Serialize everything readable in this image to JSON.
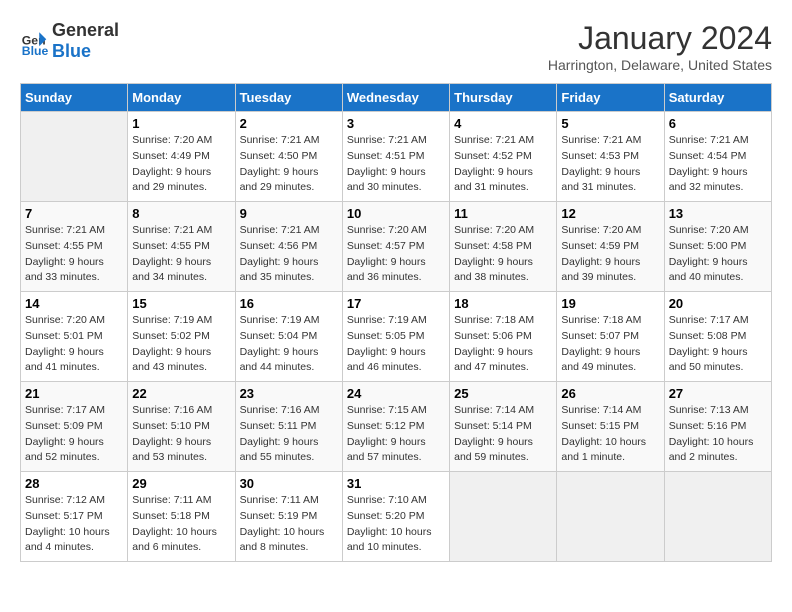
{
  "header": {
    "logo_line1": "General",
    "logo_line2": "Blue",
    "month": "January 2024",
    "location": "Harrington, Delaware, United States"
  },
  "weekdays": [
    "Sunday",
    "Monday",
    "Tuesday",
    "Wednesday",
    "Thursday",
    "Friday",
    "Saturday"
  ],
  "weeks": [
    [
      {
        "day": "",
        "info": ""
      },
      {
        "day": "1",
        "info": "Sunrise: 7:20 AM\nSunset: 4:49 PM\nDaylight: 9 hours\nand 29 minutes."
      },
      {
        "day": "2",
        "info": "Sunrise: 7:21 AM\nSunset: 4:50 PM\nDaylight: 9 hours\nand 29 minutes."
      },
      {
        "day": "3",
        "info": "Sunrise: 7:21 AM\nSunset: 4:51 PM\nDaylight: 9 hours\nand 30 minutes."
      },
      {
        "day": "4",
        "info": "Sunrise: 7:21 AM\nSunset: 4:52 PM\nDaylight: 9 hours\nand 31 minutes."
      },
      {
        "day": "5",
        "info": "Sunrise: 7:21 AM\nSunset: 4:53 PM\nDaylight: 9 hours\nand 31 minutes."
      },
      {
        "day": "6",
        "info": "Sunrise: 7:21 AM\nSunset: 4:54 PM\nDaylight: 9 hours\nand 32 minutes."
      }
    ],
    [
      {
        "day": "7",
        "info": "Sunrise: 7:21 AM\nSunset: 4:55 PM\nDaylight: 9 hours\nand 33 minutes."
      },
      {
        "day": "8",
        "info": "Sunrise: 7:21 AM\nSunset: 4:55 PM\nDaylight: 9 hours\nand 34 minutes."
      },
      {
        "day": "9",
        "info": "Sunrise: 7:21 AM\nSunset: 4:56 PM\nDaylight: 9 hours\nand 35 minutes."
      },
      {
        "day": "10",
        "info": "Sunrise: 7:20 AM\nSunset: 4:57 PM\nDaylight: 9 hours\nand 36 minutes."
      },
      {
        "day": "11",
        "info": "Sunrise: 7:20 AM\nSunset: 4:58 PM\nDaylight: 9 hours\nand 38 minutes."
      },
      {
        "day": "12",
        "info": "Sunrise: 7:20 AM\nSunset: 4:59 PM\nDaylight: 9 hours\nand 39 minutes."
      },
      {
        "day": "13",
        "info": "Sunrise: 7:20 AM\nSunset: 5:00 PM\nDaylight: 9 hours\nand 40 minutes."
      }
    ],
    [
      {
        "day": "14",
        "info": "Sunrise: 7:20 AM\nSunset: 5:01 PM\nDaylight: 9 hours\nand 41 minutes."
      },
      {
        "day": "15",
        "info": "Sunrise: 7:19 AM\nSunset: 5:02 PM\nDaylight: 9 hours\nand 43 minutes."
      },
      {
        "day": "16",
        "info": "Sunrise: 7:19 AM\nSunset: 5:04 PM\nDaylight: 9 hours\nand 44 minutes."
      },
      {
        "day": "17",
        "info": "Sunrise: 7:19 AM\nSunset: 5:05 PM\nDaylight: 9 hours\nand 46 minutes."
      },
      {
        "day": "18",
        "info": "Sunrise: 7:18 AM\nSunset: 5:06 PM\nDaylight: 9 hours\nand 47 minutes."
      },
      {
        "day": "19",
        "info": "Sunrise: 7:18 AM\nSunset: 5:07 PM\nDaylight: 9 hours\nand 49 minutes."
      },
      {
        "day": "20",
        "info": "Sunrise: 7:17 AM\nSunset: 5:08 PM\nDaylight: 9 hours\nand 50 minutes."
      }
    ],
    [
      {
        "day": "21",
        "info": "Sunrise: 7:17 AM\nSunset: 5:09 PM\nDaylight: 9 hours\nand 52 minutes."
      },
      {
        "day": "22",
        "info": "Sunrise: 7:16 AM\nSunset: 5:10 PM\nDaylight: 9 hours\nand 53 minutes."
      },
      {
        "day": "23",
        "info": "Sunrise: 7:16 AM\nSunset: 5:11 PM\nDaylight: 9 hours\nand 55 minutes."
      },
      {
        "day": "24",
        "info": "Sunrise: 7:15 AM\nSunset: 5:12 PM\nDaylight: 9 hours\nand 57 minutes."
      },
      {
        "day": "25",
        "info": "Sunrise: 7:14 AM\nSunset: 5:14 PM\nDaylight: 9 hours\nand 59 minutes."
      },
      {
        "day": "26",
        "info": "Sunrise: 7:14 AM\nSunset: 5:15 PM\nDaylight: 10 hours\nand 1 minute."
      },
      {
        "day": "27",
        "info": "Sunrise: 7:13 AM\nSunset: 5:16 PM\nDaylight: 10 hours\nand 2 minutes."
      }
    ],
    [
      {
        "day": "28",
        "info": "Sunrise: 7:12 AM\nSunset: 5:17 PM\nDaylight: 10 hours\nand 4 minutes."
      },
      {
        "day": "29",
        "info": "Sunrise: 7:11 AM\nSunset: 5:18 PM\nDaylight: 10 hours\nand 6 minutes."
      },
      {
        "day": "30",
        "info": "Sunrise: 7:11 AM\nSunset: 5:19 PM\nDaylight: 10 hours\nand 8 minutes."
      },
      {
        "day": "31",
        "info": "Sunrise: 7:10 AM\nSunset: 5:20 PM\nDaylight: 10 hours\nand 10 minutes."
      },
      {
        "day": "",
        "info": ""
      },
      {
        "day": "",
        "info": ""
      },
      {
        "day": "",
        "info": ""
      }
    ]
  ]
}
